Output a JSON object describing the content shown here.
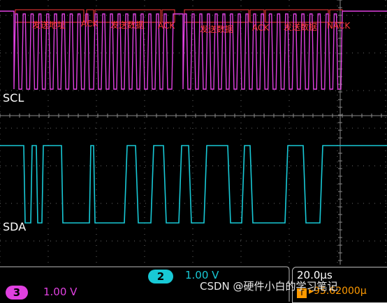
{
  "channels": {
    "scl": {
      "label": "SCL",
      "color": "#e040e0"
    },
    "sda": {
      "label": "SDA",
      "color": "#18c9d6"
    }
  },
  "annotations": [
    "发送地址",
    "ACK",
    "发送数据",
    "ACK",
    "发送数据",
    "ACK",
    "发送数据",
    "NACK"
  ],
  "status": {
    "ch2_num": "2",
    "ch2_scale": "1.00 V",
    "ch3_num": "3",
    "ch3_scale": "1.00 V",
    "time_div": "20.0µs",
    "trigger_glyph": "T",
    "trigger_pos": "▸95.62000µ"
  },
  "watermark": "CSDN @硬件小白的学习笔记",
  "colors": {
    "accent_red": "#ff3a3a",
    "trigger": "#ff9a00",
    "grid": "#6a6a6a"
  }
}
